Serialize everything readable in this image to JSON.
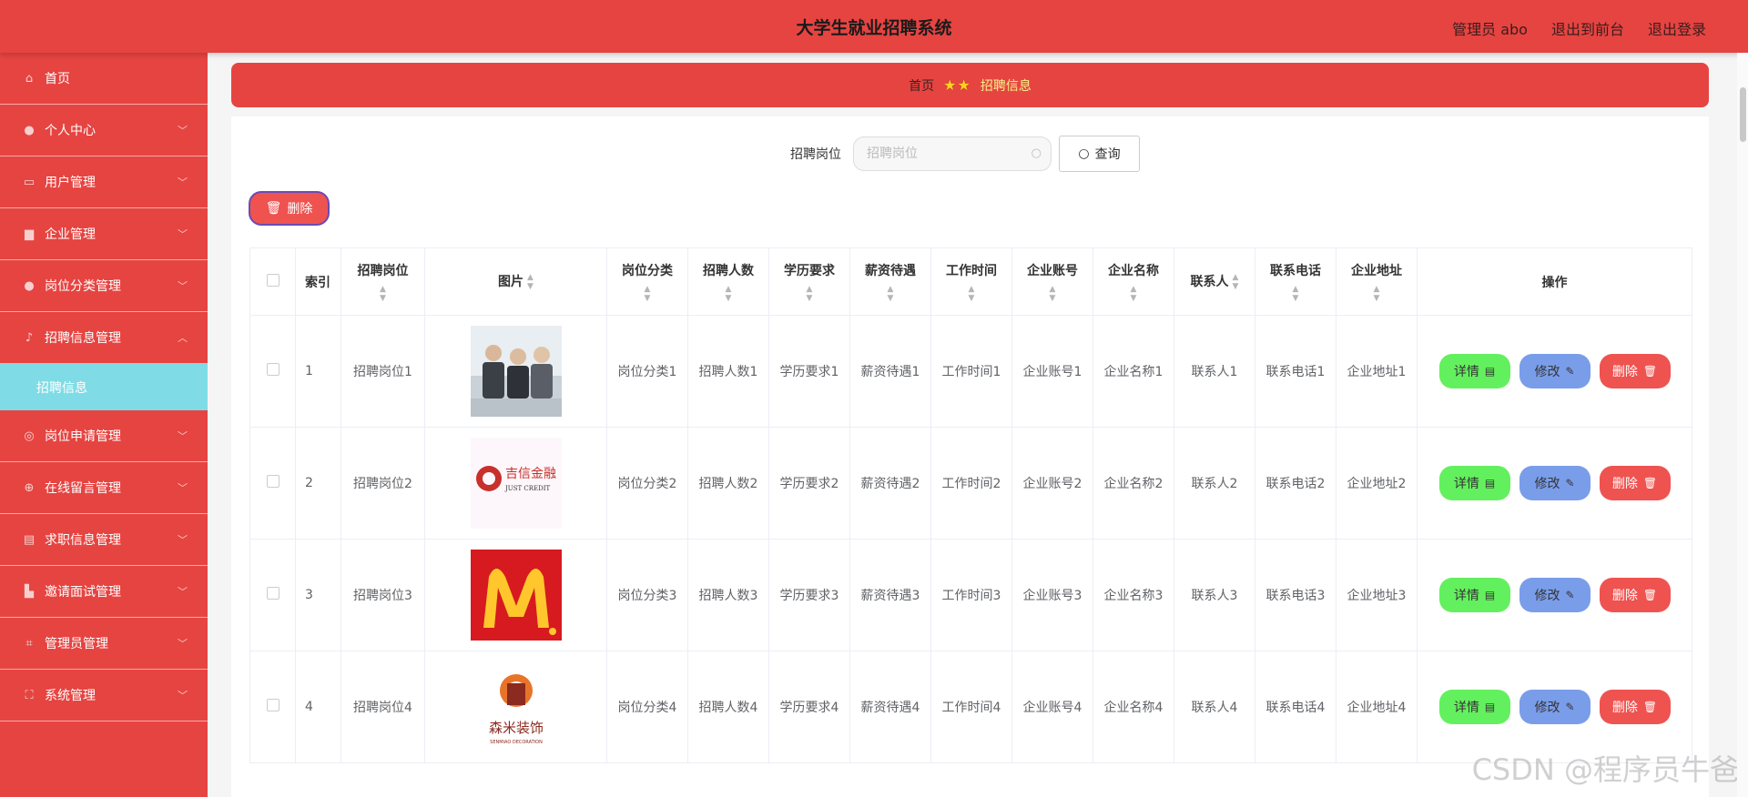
{
  "header": {
    "title": "大学生就业招聘系统",
    "admin": "管理员 abo",
    "to_front": "退出到前台",
    "logout": "退出登录"
  },
  "sidebar": {
    "items": [
      {
        "label": "首页",
        "icon": "home-icon"
      },
      {
        "label": "个人中心",
        "icon": "user-icon"
      },
      {
        "label": "用户管理",
        "icon": "id-card-icon"
      },
      {
        "label": "企业管理",
        "icon": "briefcase-icon"
      },
      {
        "label": "岗位分类管理",
        "icon": "location-icon"
      },
      {
        "label": "招聘信息管理",
        "icon": "microphone-icon"
      },
      {
        "label": "岗位申请管理",
        "icon": "compass-icon"
      },
      {
        "label": "在线留言管理",
        "icon": "target-icon"
      },
      {
        "label": "求职信息管理",
        "icon": "clipboard-icon"
      },
      {
        "label": "邀请面试管理",
        "icon": "thumb-icon"
      },
      {
        "label": "管理员管理",
        "icon": "crop-icon"
      },
      {
        "label": "系统管理",
        "icon": "fullscreen-icon"
      }
    ],
    "submenu_active": "招聘信息"
  },
  "breadcrumb": {
    "home": "首页",
    "current": "招聘信息"
  },
  "search": {
    "label": "招聘岗位",
    "placeholder": "招聘岗位",
    "value": "",
    "button": "查询"
  },
  "toolbar": {
    "delete_label": "删除"
  },
  "table": {
    "headers": [
      "索引",
      "招聘岗位",
      "图片",
      "岗位分类",
      "招聘人数",
      "学历要求",
      "薪资待遇",
      "工作时间",
      "企业账号",
      "企业名称",
      "联系人",
      "联系电话",
      "企业地址",
      "操作"
    ],
    "actions": {
      "detail": "详情",
      "edit": "修改",
      "delete": "删除"
    },
    "rows": [
      {
        "index": "1",
        "cells": [
          "招聘岗位1",
          "岗位分类1",
          "招聘人数1",
          "学历要求1",
          "薪资待遇1",
          "工作时间1",
          "企业账号1",
          "企业名称1",
          "联系人1",
          "联系电话1",
          "企业地址1"
        ],
        "logo_text": ""
      },
      {
        "index": "2",
        "cells": [
          "招聘岗位2",
          "岗位分类2",
          "招聘人数2",
          "学历要求2",
          "薪资待遇2",
          "工作时间2",
          "企业账号2",
          "企业名称2",
          "联系人2",
          "联系电话2",
          "企业地址2"
        ],
        "logo_text": "吉信金融",
        "logo_sub": "JUST CREDIT"
      },
      {
        "index": "3",
        "cells": [
          "招聘岗位3",
          "岗位分类3",
          "招聘人数3",
          "学历要求3",
          "薪资待遇3",
          "工作时间3",
          "企业账号3",
          "企业名称3",
          "联系人3",
          "联系电话3",
          "企业地址3"
        ],
        "logo_text": ""
      },
      {
        "index": "4",
        "cells": [
          "招聘岗位4",
          "岗位分类4",
          "招聘人数4",
          "学历要求4",
          "薪资待遇4",
          "工作时间4",
          "企业账号4",
          "企业名称4",
          "联系人4",
          "联系电话4",
          "企业地址4"
        ],
        "logo_text": "森米装饰",
        "logo_sub": "SENMIAO DECORATION"
      }
    ]
  },
  "watermark": "CSDN @程序员牛爸",
  "colors": {
    "brand": "#e64441",
    "submenu": "#7fdce6",
    "detail": "#63f05e",
    "edit": "#7a9de9",
    "delete": "#ef5350"
  }
}
